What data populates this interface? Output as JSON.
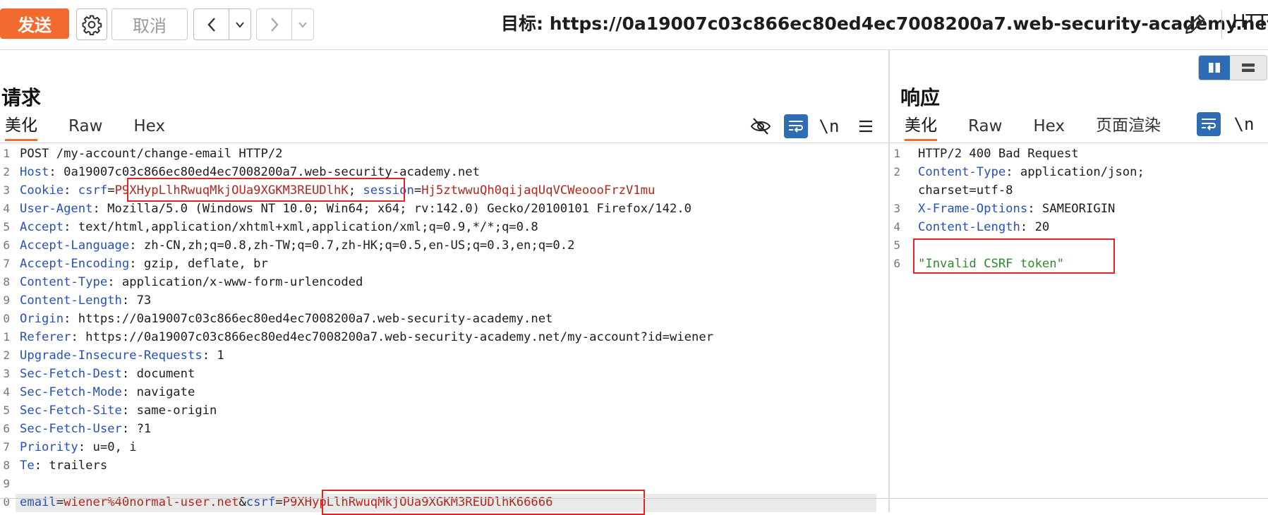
{
  "toolbar": {
    "send": "发送",
    "cancel": "取消",
    "target_label": "目标: ",
    "target_url": "https://0a19007c03c866ec80ed4ec7008200a7.web-security-academy.net",
    "http_trunc": "HTT"
  },
  "request": {
    "title": "请求",
    "tabs": [
      "美化",
      "Raw",
      "Hex"
    ],
    "newline_icon": "\\n",
    "lines": [
      {
        "n": "1",
        "segs": [
          {
            "t": "POST /my-account/change-email HTTP/2",
            "c": ""
          }
        ]
      },
      {
        "n": "2",
        "segs": [
          {
            "t": "Host",
            "c": "k"
          },
          {
            "t": ": 0a19007c03c866ec80ed4ec7008200a7.web-security-academy.net",
            "c": ""
          }
        ]
      },
      {
        "n": "3",
        "segs": [
          {
            "t": "Cookie",
            "c": "k"
          },
          {
            "t": ": ",
            "c": ""
          },
          {
            "t": "csrf",
            "c": "k"
          },
          {
            "t": "=",
            "c": ""
          },
          {
            "t": "P9XHypLlhRwuqMkjOUa9XGKM3REUDlhK",
            "c": "v"
          },
          {
            "t": "; ",
            "c": ""
          },
          {
            "t": "session",
            "c": "k"
          },
          {
            "t": "=",
            "c": ""
          },
          {
            "t": "Hj5ztwwuQh0qijaqUqVCWeoooFrzV1mu",
            "c": "v"
          }
        ]
      },
      {
        "n": "4",
        "segs": [
          {
            "t": "User-Agent",
            "c": "k"
          },
          {
            "t": ": Mozilla/5.0 (Windows NT 10.0; Win64; x64; rv:142.0) Gecko/20100101 Firefox/142.0",
            "c": ""
          }
        ]
      },
      {
        "n": "5",
        "segs": [
          {
            "t": "Accept",
            "c": "k"
          },
          {
            "t": ": text/html,application/xhtml+xml,application/xml;q=0.9,*/*;q=0.8",
            "c": ""
          }
        ]
      },
      {
        "n": "6",
        "segs": [
          {
            "t": "Accept-Language",
            "c": "k"
          },
          {
            "t": ": zh-CN,zh;q=0.8,zh-TW;q=0.7,zh-HK;q=0.5,en-US;q=0.3,en;q=0.2",
            "c": ""
          }
        ]
      },
      {
        "n": "7",
        "segs": [
          {
            "t": "Accept-Encoding",
            "c": "k"
          },
          {
            "t": ": gzip, deflate, br",
            "c": ""
          }
        ]
      },
      {
        "n": "8",
        "segs": [
          {
            "t": "Content-Type",
            "c": "k"
          },
          {
            "t": ": application/x-www-form-urlencoded",
            "c": ""
          }
        ]
      },
      {
        "n": "9",
        "segs": [
          {
            "t": "Content-Length",
            "c": "k"
          },
          {
            "t": ": 73",
            "c": ""
          }
        ]
      },
      {
        "n": "0",
        "segs": [
          {
            "t": "Origin",
            "c": "k"
          },
          {
            "t": ": https://0a19007c03c866ec80ed4ec7008200a7.web-security-academy.net",
            "c": ""
          }
        ]
      },
      {
        "n": "1",
        "segs": [
          {
            "t": "Referer",
            "c": "k"
          },
          {
            "t": ": https://0a19007c03c866ec80ed4ec7008200a7.web-security-academy.net/my-account?id=wiener",
            "c": ""
          }
        ]
      },
      {
        "n": "2",
        "segs": [
          {
            "t": "Upgrade-Insecure-Requests",
            "c": "k"
          },
          {
            "t": ": 1",
            "c": ""
          }
        ]
      },
      {
        "n": "3",
        "segs": [
          {
            "t": "Sec-Fetch-Dest",
            "c": "k"
          },
          {
            "t": ": document",
            "c": ""
          }
        ]
      },
      {
        "n": "4",
        "segs": [
          {
            "t": "Sec-Fetch-Mode",
            "c": "k"
          },
          {
            "t": ": navigate",
            "c": ""
          }
        ]
      },
      {
        "n": "5",
        "segs": [
          {
            "t": "Sec-Fetch-Site",
            "c": "k"
          },
          {
            "t": ": same-origin",
            "c": ""
          }
        ]
      },
      {
        "n": "6",
        "segs": [
          {
            "t": "Sec-Fetch-User",
            "c": "k"
          },
          {
            "t": ": ?1",
            "c": ""
          }
        ]
      },
      {
        "n": "7",
        "segs": [
          {
            "t": "Priority",
            "c": "k"
          },
          {
            "t": ": u=0, i",
            "c": ""
          }
        ]
      },
      {
        "n": "8",
        "segs": [
          {
            "t": "Te",
            "c": "k"
          },
          {
            "t": ": trailers",
            "c": ""
          }
        ]
      },
      {
        "n": "9",
        "segs": []
      },
      {
        "n": "0",
        "segs": [
          {
            "t": "email",
            "c": "k"
          },
          {
            "t": "=",
            "c": ""
          },
          {
            "t": "wiener%40normal-user.net",
            "c": "v"
          },
          {
            "t": "&",
            "c": ""
          },
          {
            "t": "csrf",
            "c": "k"
          },
          {
            "t": "=",
            "c": ""
          },
          {
            "t": "P9XHypLlhRwuqMkjOUa9XGKM3REUDlhK66666",
            "c": "v"
          }
        ]
      }
    ]
  },
  "response": {
    "title": "响应",
    "tabs": [
      "美化",
      "Raw",
      "Hex",
      "页面渲染"
    ],
    "newline_icon": "\\n",
    "lines": [
      {
        "n": "1",
        "segs": [
          {
            "t": "HTTP/2 400 Bad Request",
            "c": ""
          }
        ]
      },
      {
        "n": "2",
        "segs": [
          {
            "t": "Content-Type",
            "c": "k"
          },
          {
            "t": ": application/json;",
            "c": ""
          }
        ]
      },
      {
        "n": "",
        "segs": [
          {
            "t": "charset=utf-8",
            "c": ""
          }
        ]
      },
      {
        "n": "3",
        "segs": [
          {
            "t": "X-Frame-Options",
            "c": "k"
          },
          {
            "t": ": SAMEORIGIN",
            "c": ""
          }
        ]
      },
      {
        "n": "4",
        "segs": [
          {
            "t": "Content-Length",
            "c": "k"
          },
          {
            "t": ": 20",
            "c": ""
          }
        ]
      },
      {
        "n": "5",
        "segs": []
      },
      {
        "n": "6",
        "segs": [
          {
            "t": "\"Invalid CSRF token\"",
            "c": "g"
          }
        ]
      }
    ]
  }
}
